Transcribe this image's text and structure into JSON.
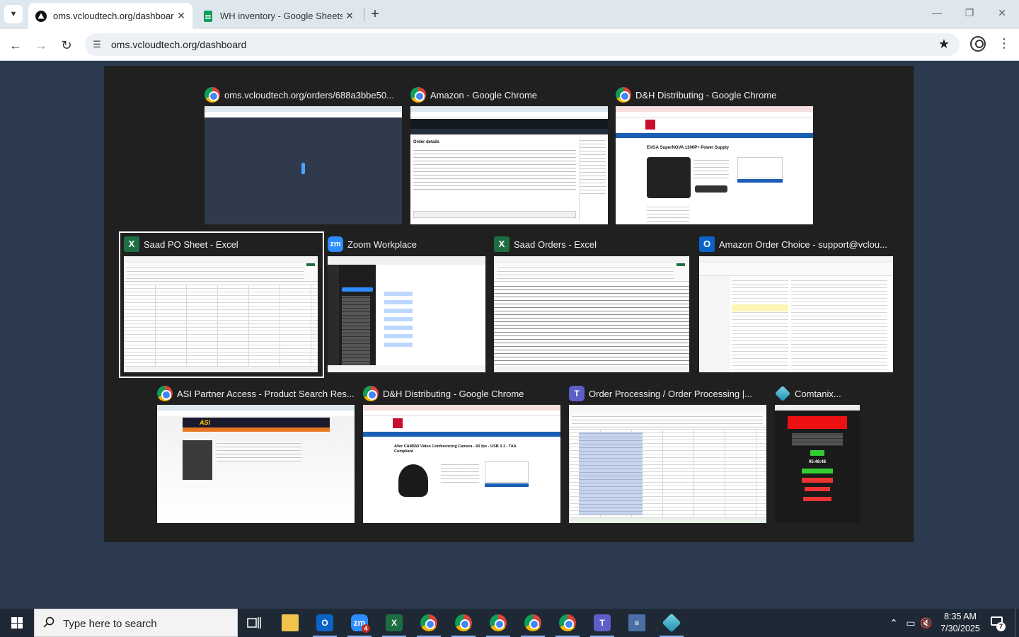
{
  "browser": {
    "tabs": [
      {
        "label": "oms.vcloudtech.org/dashboard",
        "active": true,
        "favicon": "triangle-logo-icon"
      },
      {
        "label": "WH inventory - Google Sheets",
        "active": false,
        "favicon": "sheets-icon"
      }
    ],
    "url": "oms.vcloudtech.org/dashboard"
  },
  "switcher": {
    "windows": [
      {
        "title": "oms.vcloudtech.org/orders/688a3bbe50...",
        "icon": "chrome-icon"
      },
      {
        "title": "Amazon - Google Chrome",
        "icon": "chrome-icon"
      },
      {
        "title": "D&H Distributing - Google Chrome",
        "icon": "chrome-icon"
      },
      {
        "title": "Saad PO Sheet - Excel",
        "icon": "excel-icon",
        "selected": true
      },
      {
        "title": "Zoom Workplace",
        "icon": "zoom-icon"
      },
      {
        "title": "Saad Orders - Excel",
        "icon": "excel-icon"
      },
      {
        "title": "Amazon Order Choice - support@vclou...",
        "icon": "outlook-icon"
      },
      {
        "title": "ASI Partner Access - Product Search Res...",
        "icon": "chrome-icon"
      },
      {
        "title": "D&H Distributing - Google Chrome",
        "icon": "chrome-icon"
      },
      {
        "title": "Order Processing / Order Processing |...",
        "icon": "teams-icon"
      },
      {
        "title": "Comtanix...",
        "icon": "comtanix-icon"
      }
    ],
    "thumb_text": {
      "amazon_heading": "Order details",
      "dh_product_1": "EVGA SuperNOVA 1300P+ Power Supply",
      "dh_product_2": "AVer CAM550 Video Conferencing Camera - 60 fps - USB 3.1 - TAA Compliant",
      "asi_logo": "ASI",
      "comtanix_timer": "05:48:48"
    }
  },
  "taskbar": {
    "search_placeholder": "Type here to search",
    "zoom_badge": "4",
    "time": "8:35 AM",
    "date": "7/30/2025",
    "notification_count": "7"
  }
}
